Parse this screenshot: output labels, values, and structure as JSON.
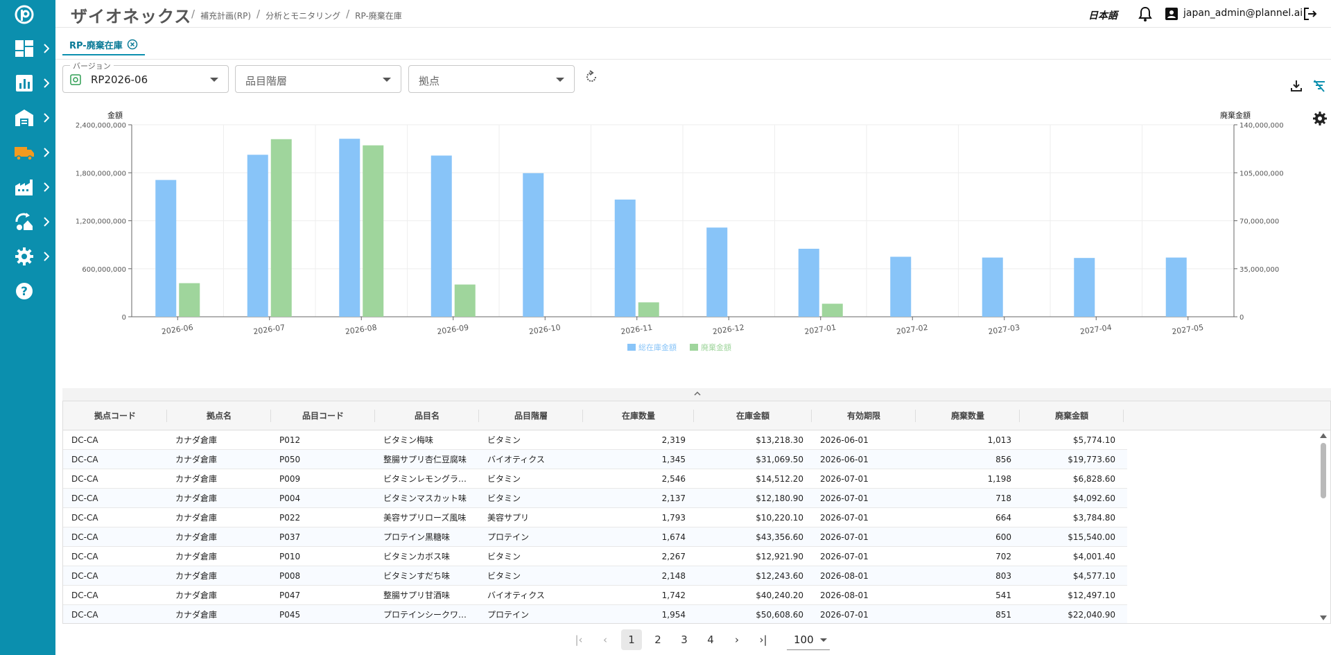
{
  "header": {
    "brand": "ザイオネックス",
    "breadcrumbs": [
      "補充計画(RP)",
      "分析とモニタリング",
      "RP-廃棄在庫"
    ],
    "language": "日本語",
    "user": "japan_admin@plannel.ai"
  },
  "sidebar": {
    "items": [
      {
        "icon": "dashboard-icon"
      },
      {
        "icon": "chart-icon"
      },
      {
        "icon": "warehouse-icon"
      },
      {
        "icon": "truck-icon"
      },
      {
        "icon": "factory-icon"
      },
      {
        "icon": "cycle-icon"
      },
      {
        "icon": "gear-icon"
      },
      {
        "icon": "help-icon"
      }
    ]
  },
  "tab": {
    "label": "RP-廃棄在庫"
  },
  "filters": {
    "version_label": "バージョン",
    "version_value": "RP2026-06",
    "item_level_placeholder": "品目階層",
    "site_placeholder": "拠点"
  },
  "chart_data": {
    "type": "bar",
    "categories": [
      "2026-06",
      "2026-07",
      "2026-08",
      "2026-09",
      "2026-10",
      "2026-11",
      "2026-12",
      "2027-01",
      "2027-02",
      "2027-03",
      "2027-04",
      "2027-05"
    ],
    "series": [
      {
        "name": "総在庫金額",
        "axis": "left",
        "color": "#88c4f8",
        "values": [
          1710000000,
          2025000000,
          2225000000,
          2015000000,
          1795000000,
          1465000000,
          1115000000,
          850000000,
          750000000,
          740000000,
          735000000,
          740000000
        ]
      },
      {
        "name": "廃棄金額",
        "axis": "right",
        "color": "#9fd59c",
        "values": [
          24500000,
          129500000,
          125000000,
          23500000,
          0,
          10500000,
          0,
          9500000,
          0,
          0,
          0,
          0
        ]
      }
    ],
    "ylabel_left": "金額",
    "ylabel_right": "廃棄金額",
    "ylim_left": [
      0,
      2400000000
    ],
    "ylim_right": [
      0,
      140000000
    ],
    "yticks_left": [
      "0",
      "600,000,000",
      "1,200,000,000",
      "1,800,000,000",
      "2,400,000,000"
    ],
    "yticks_right": [
      "0",
      "35,000,000",
      "70,000,000",
      "105,000,000",
      "140,000,000"
    ],
    "legend_position": "bottom-center",
    "grid": true
  },
  "table": {
    "columns": [
      "拠点コード",
      "拠点名",
      "品目コード",
      "品目名",
      "品目階層",
      "在庫数量",
      "在庫金額",
      "有効期限",
      "廃棄数量",
      "廃棄金額"
    ],
    "rows": [
      [
        "DC-CA",
        "カナダ倉庫",
        "P012",
        "ビタミン梅味",
        "ビタミン",
        "2,319",
        "$13,218.30",
        "2026-06-01",
        "1,013",
        "$5,774.10"
      ],
      [
        "DC-CA",
        "カナダ倉庫",
        "P050",
        "整腸サプリ杏仁豆腐味",
        "バイオティクス",
        "1,345",
        "$31,069.50",
        "2026-06-01",
        "856",
        "$19,773.60"
      ],
      [
        "DC-CA",
        "カナダ倉庫",
        "P009",
        "ビタミンレモングラ…",
        "ビタミン",
        "2,546",
        "$14,512.20",
        "2026-07-01",
        "1,198",
        "$6,828.60"
      ],
      [
        "DC-CA",
        "カナダ倉庫",
        "P004",
        "ビタミンマスカット味",
        "ビタミン",
        "2,137",
        "$12,180.90",
        "2026-07-01",
        "718",
        "$4,092.60"
      ],
      [
        "DC-CA",
        "カナダ倉庫",
        "P022",
        "美容サプリローズ風味",
        "美容サプリ",
        "1,793",
        "$10,220.10",
        "2026-07-01",
        "664",
        "$3,784.80"
      ],
      [
        "DC-CA",
        "カナダ倉庫",
        "P037",
        "プロテイン黒糖味",
        "プロテイン",
        "1,674",
        "$43,356.60",
        "2026-07-01",
        "600",
        "$15,540.00"
      ],
      [
        "DC-CA",
        "カナダ倉庫",
        "P010",
        "ビタミンカボス味",
        "ビタミン",
        "2,267",
        "$12,921.90",
        "2026-07-01",
        "702",
        "$4,001.40"
      ],
      [
        "DC-CA",
        "カナダ倉庫",
        "P008",
        "ビタミンすだち味",
        "ビタミン",
        "2,148",
        "$12,243.60",
        "2026-08-01",
        "803",
        "$4,577.10"
      ],
      [
        "DC-CA",
        "カナダ倉庫",
        "P047",
        "整腸サプリ甘酒味",
        "バイオティクス",
        "1,742",
        "$40,240.20",
        "2026-08-01",
        "541",
        "$12,497.10"
      ],
      [
        "DC-CA",
        "カナダ倉庫",
        "P045",
        "プロテインシークワ…",
        "プロテイン",
        "1,954",
        "$50,608.60",
        "2026-07-01",
        "851",
        "$22,040.90"
      ]
    ]
  },
  "pagination": {
    "pages": [
      "1",
      "2",
      "3",
      "4"
    ],
    "current": "1",
    "page_size": "100"
  }
}
